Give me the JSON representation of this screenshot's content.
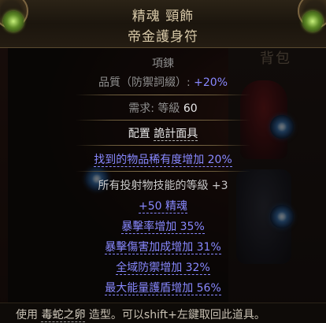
{
  "inventory": {
    "title": "背包"
  },
  "item": {
    "name": "精魂 頸飾",
    "base_type": "帝金護身符",
    "item_class": "項鍊",
    "quality_label": "品質（防禦詞綴）:",
    "quality_value": "+20%",
    "requirement_label": "需求: 等級 ",
    "requirement_level": "60",
    "config_label": "配置",
    "config_value": "詭計面具",
    "implicit": "找到的物品稀有度增加 20%",
    "enchant": "所有投射物技能的等級 +3",
    "mods": [
      "+50 精魂",
      "暴擊率增加 35%",
      "暴擊傷害加成增加 31%",
      "全域防禦增加 32%",
      "最大能量護盾增加 56%"
    ]
  },
  "hint": {
    "prefix": "使用",
    "item": "毒蛇之卵",
    "suffix": "造型。可以shift+左鍵取回此道具。"
  },
  "colors": {
    "magic_blue": "#8888ff",
    "header_text": "#d8c9a8",
    "label_grey": "#8f8f8f",
    "corner_gem": "#8fbf3a"
  },
  "icons": {
    "corner_gem_left": "green-gem-icon",
    "corner_gem_right": "green-gem-icon",
    "socket_orb": "blue-orb-icon"
  }
}
